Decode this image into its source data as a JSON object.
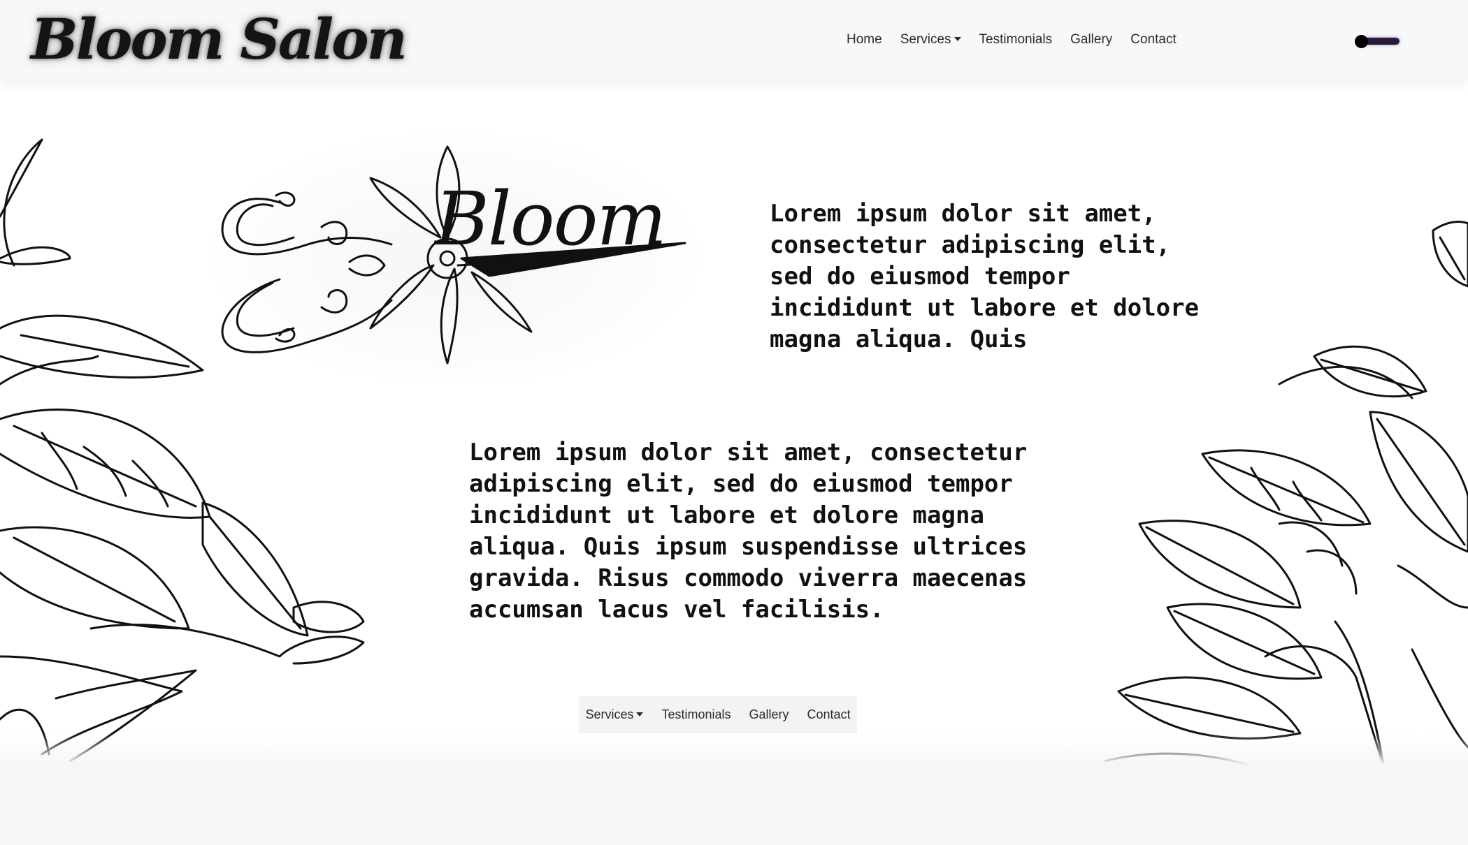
{
  "brand": {
    "name": "Bloom Salon"
  },
  "nav": {
    "links": [
      {
        "label": "Home"
      },
      {
        "label": "Services",
        "dropdown": true
      },
      {
        "label": "Testimonials"
      },
      {
        "label": "Gallery"
      },
      {
        "label": "Contact"
      }
    ]
  },
  "theme_toggle": {
    "state": "dark",
    "accent": "#2a1a3a"
  },
  "logo": {
    "word": "Bloom",
    "icon": "scissors-flower-icon"
  },
  "content": {
    "para_1": "Lorem ipsum dolor sit amet, consectetur adipiscing elit, sed do eiusmod tempor incididunt ut labore et dolore magna aliqua. Quis",
    "para_2": "Lorem ipsum dolor sit amet, consectetur adipiscing elit, sed do eiusmod tempor incididunt ut labore et dolore magna aliqua. Quis ipsum suspendisse ultrices gravida. Risus commodo viverra maecenas accumsan lacus vel facilisis."
  },
  "footer_nav": {
    "links": [
      {
        "label": "Services",
        "dropdown": true
      },
      {
        "label": "Testimonials"
      },
      {
        "label": "Gallery"
      },
      {
        "label": "Contact"
      }
    ]
  }
}
